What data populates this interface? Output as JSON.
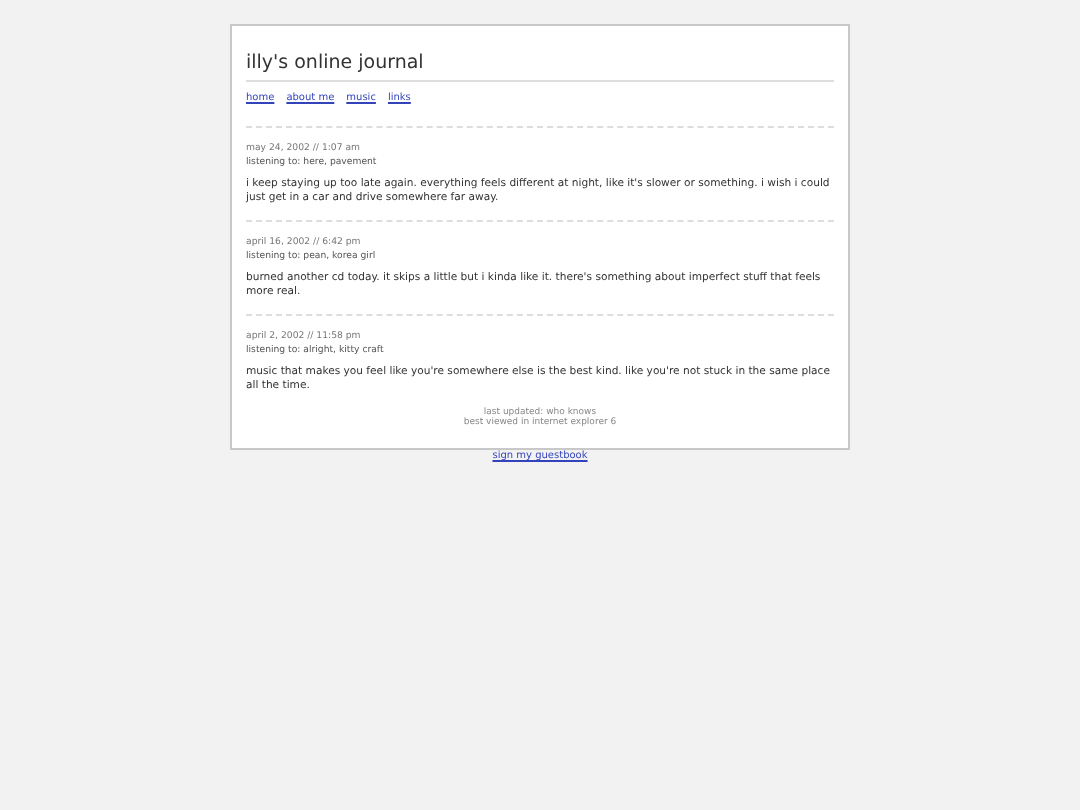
{
  "title": "illy's online journal",
  "nav": [
    "home",
    "about me",
    "music",
    "links"
  ],
  "entries": [
    {
      "date": "may 24, 2002 // 1:07 am",
      "listening": "listening to: here, pavement",
      "text": "i keep staying up too late again. everything feels different at night, like it's slower or something. i wish i could just get in a car and drive somewhere far away."
    },
    {
      "date": "april 16, 2002 // 6:42 pm",
      "listening": "listening to: pean, korea girl",
      "text": "burned another cd today. it skips a little but i kinda like it. there's something about imperfect stuff that feels more real."
    },
    {
      "date": "april 2, 2002 // 11:58 pm",
      "listening": "listening to: alright, kitty craft",
      "text": "music that makes you feel like you're somewhere else is the best kind. like you're not stuck in the same place all the time."
    }
  ],
  "footer": {
    "lines": [
      "last updated: who knows",
      "best viewed in internet explorer 6"
    ],
    "link": "sign my guestbook"
  }
}
